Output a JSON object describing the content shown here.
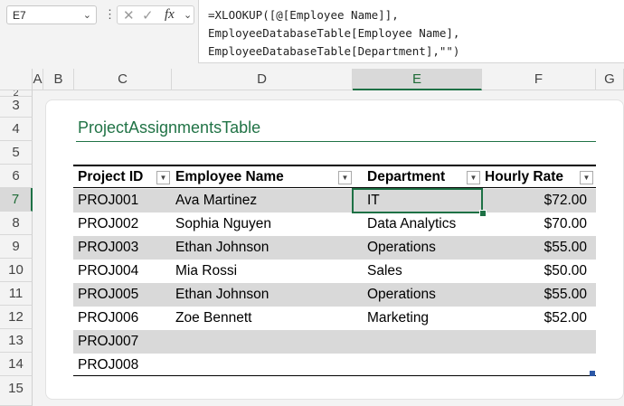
{
  "formula_bar": {
    "name_box": "E7",
    "formula_lines": [
      "=XLOOKUP([@[Employee Name]],",
      "EmployeeDatabaseTable[Employee Name],",
      "EmployeeDatabaseTable[Department],\"\")"
    ]
  },
  "columns": [
    "A",
    "B",
    "C",
    "D",
    "E",
    "F",
    "G"
  ],
  "rows": [
    "2",
    "3",
    "4",
    "5",
    "6",
    "7",
    "8",
    "9",
    "10",
    "11",
    "12",
    "13",
    "14",
    "15"
  ],
  "selected_cell": "E7",
  "table": {
    "title": "ProjectAssignmentsTable",
    "headers": [
      "Project ID",
      "Employee Name",
      "Department",
      "Hourly Rate"
    ],
    "rows": [
      [
        "PROJ001",
        "Ava Martinez",
        "IT",
        "$72.00"
      ],
      [
        "PROJ002",
        "Sophia Nguyen",
        "Data Analytics",
        "$70.00"
      ],
      [
        "PROJ003",
        "Ethan Johnson",
        "Operations",
        "$55.00"
      ],
      [
        "PROJ004",
        "Mia Rossi",
        "Sales",
        "$50.00"
      ],
      [
        "PROJ005",
        "Ethan Johnson",
        "Operations",
        "$55.00"
      ],
      [
        "PROJ006",
        "Zoe Bennett",
        "Marketing",
        "$52.00"
      ],
      [
        "PROJ007",
        "",
        "",
        ""
      ],
      [
        "PROJ008",
        "",
        "",
        ""
      ]
    ]
  },
  "colors": {
    "accent": "#217346",
    "selection": "#1e7145",
    "band": "#d9d9d9"
  }
}
